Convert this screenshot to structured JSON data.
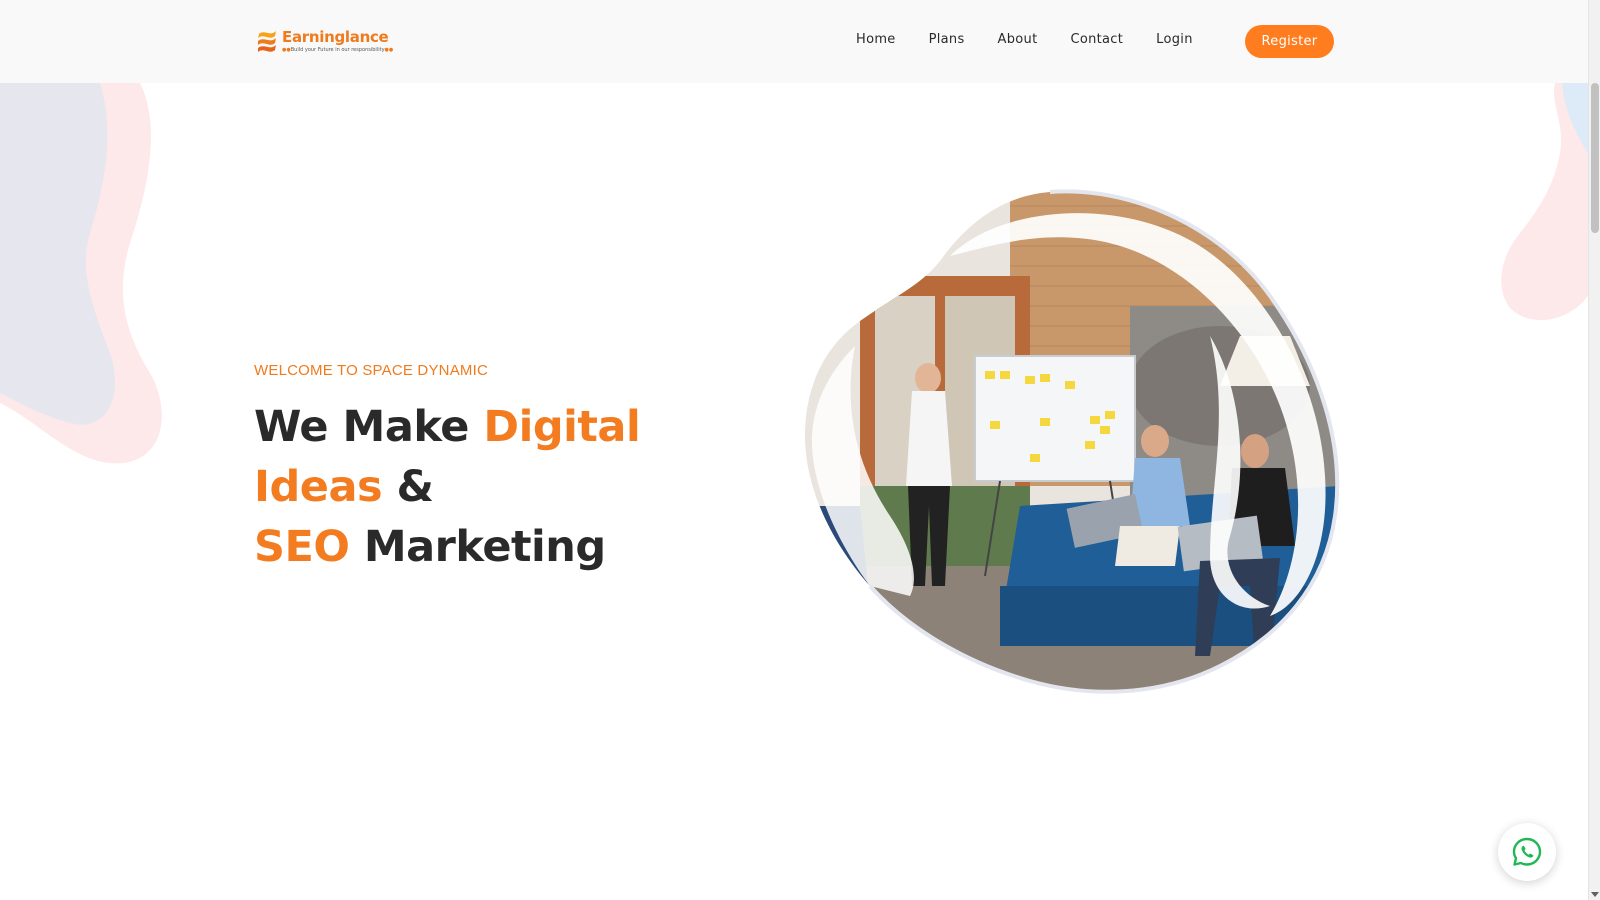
{
  "brand": {
    "name": "Earninglance",
    "tagline": "Build your Future in our responsibility",
    "accent_color": "#f47c20"
  },
  "nav": {
    "items": [
      {
        "label": "Home"
      },
      {
        "label": "Plans"
      },
      {
        "label": "About"
      },
      {
        "label": "Contact"
      },
      {
        "label": "Login"
      }
    ],
    "register_label": "Register"
  },
  "hero": {
    "eyebrow": "WELCOME TO SPACE DYNAMIC",
    "headline": {
      "part1": "We Make ",
      "accent1": "Digital Ideas",
      "part2": " & ",
      "accent2": "SEO",
      "part3": " Marketing"
    },
    "image_icon": "team-meeting-illustration"
  },
  "floating": {
    "whatsapp_icon": "whatsapp-icon"
  }
}
